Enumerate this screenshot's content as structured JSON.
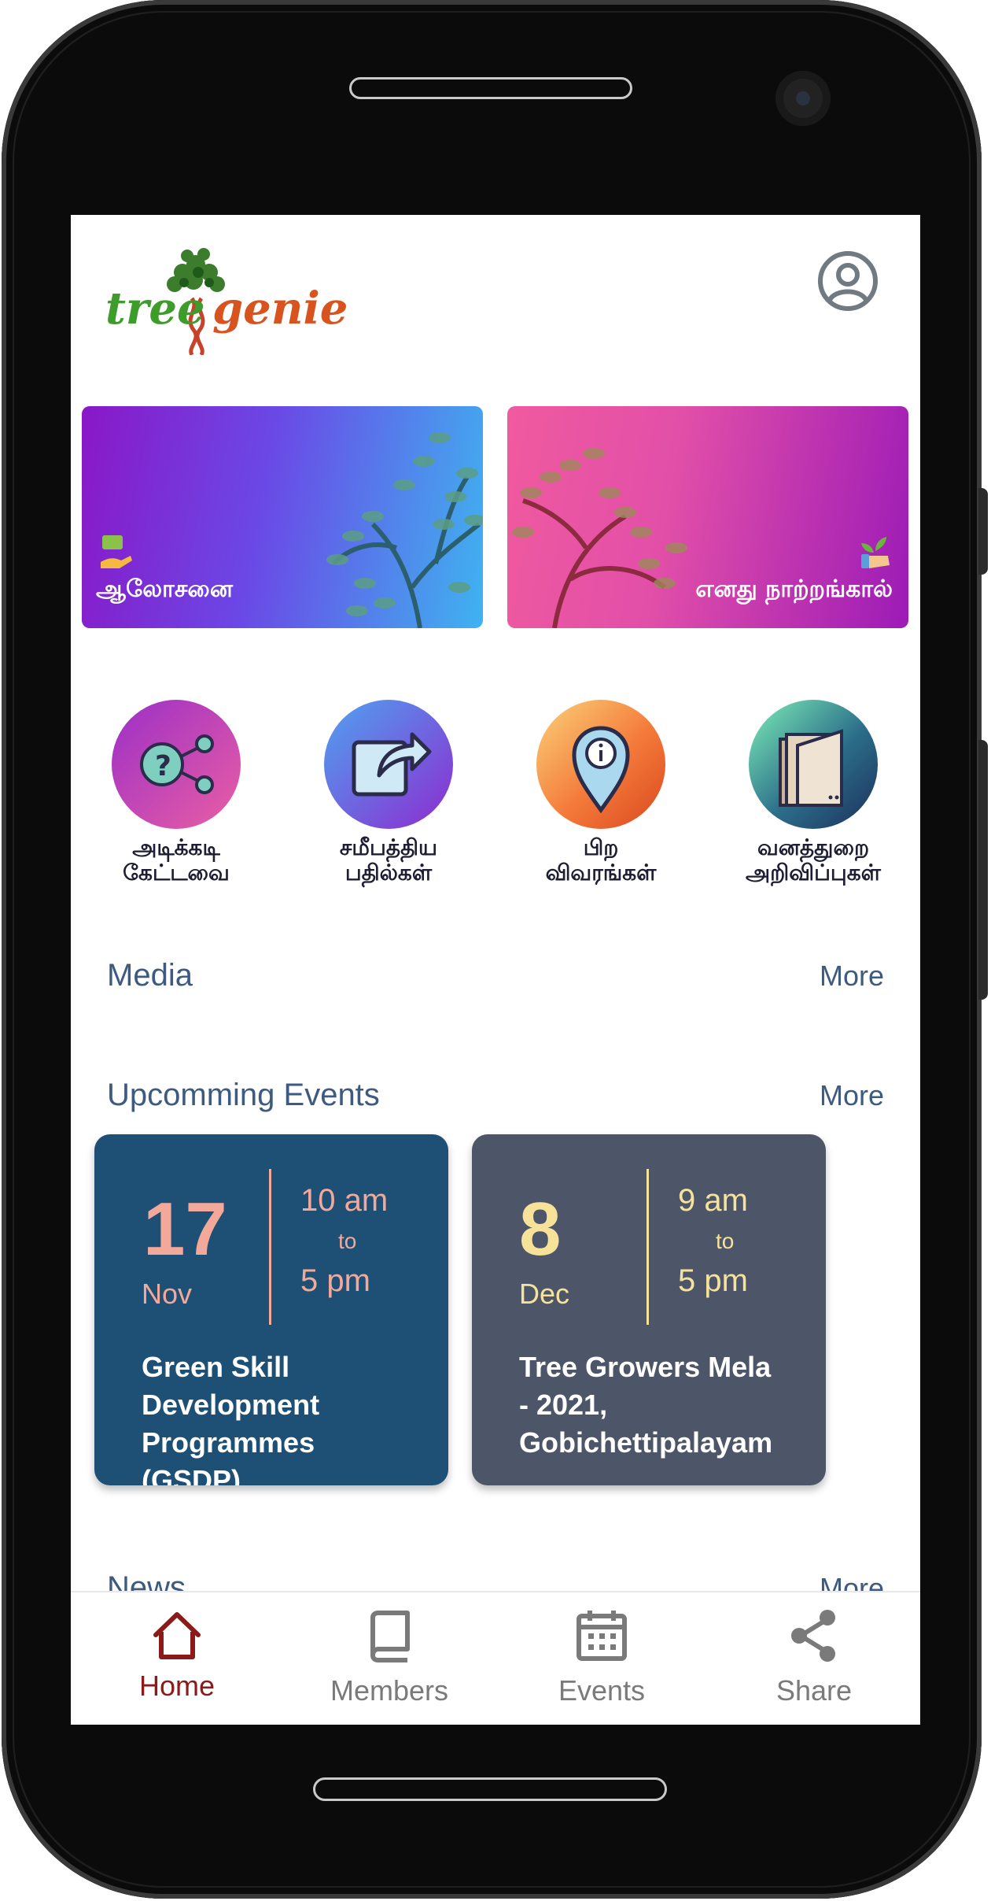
{
  "app": {
    "logo_part1": "tree",
    "logo_part2": "genie"
  },
  "banners": [
    {
      "label": "ஆலோசனை",
      "icon": "consult-hand-icon"
    },
    {
      "label": "எனது நாற்றங்கால்",
      "icon": "seedling-hand-icon"
    }
  ],
  "shortcuts": [
    {
      "line1": "அடிக்கடி",
      "line2": "கேட்டவை",
      "icon": "faq-icon"
    },
    {
      "line1": "சமீபத்திய",
      "line2": "பதில்கள்",
      "icon": "share-out-icon"
    },
    {
      "line1": "பிற",
      "line2": "விவரங்கள்",
      "icon": "info-pin-icon"
    },
    {
      "line1": "வனத்துறை",
      "line2": "அறிவிப்புகள்",
      "icon": "folder-icon"
    }
  ],
  "media": {
    "title": "Media",
    "more": "More"
  },
  "events": {
    "title": "Upcomming Events",
    "more": "More",
    "items": [
      {
        "day": "17",
        "month": "Nov",
        "start": "10 am",
        "to": "to",
        "end": "5 pm",
        "title": "Green Skill Development Programmes (GSDP) ...",
        "bg": "#1e4f74",
        "accent": "#f3a99a"
      },
      {
        "day": "8",
        "month": "Dec",
        "start": "9 am",
        "to": "to",
        "end": "5 pm",
        "title": "Tree Growers Mela - 2021, Gobichettipalayam ...",
        "bg": "#4c5668",
        "accent": "#f7e29a"
      }
    ]
  },
  "news": {
    "title": "News",
    "more": "More"
  },
  "nav": {
    "active": "home",
    "items": [
      {
        "key": "home",
        "label": "Home",
        "icon": "home-icon"
      },
      {
        "key": "members",
        "label": "Members",
        "icon": "book-icon"
      },
      {
        "key": "events",
        "label": "Events",
        "icon": "calendar-icon"
      },
      {
        "key": "share",
        "label": "Share",
        "icon": "share-icon"
      }
    ],
    "active_color": "#8b1a1a"
  }
}
